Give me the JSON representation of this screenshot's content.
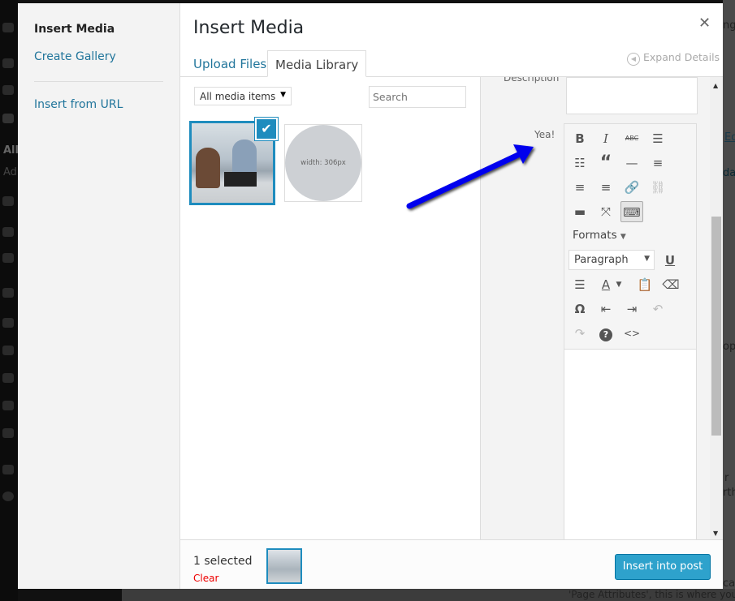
{
  "background": {
    "fragments": [
      "nge",
      "Ed",
      "dat",
      "ope",
      "r",
      "rth",
      "cal",
      "'Page Attributes', this is where you",
      "All",
      "Ad"
    ]
  },
  "left_menu": {
    "items": [
      {
        "label": "Insert Media",
        "active": true
      },
      {
        "label": "Create Gallery",
        "active": false
      },
      {
        "label": "Insert from URL",
        "active": false
      }
    ]
  },
  "header": {
    "title": "Insert Media",
    "close_icon": "close-icon"
  },
  "tabs": [
    {
      "label": "Upload Files"
    },
    {
      "label": "Media Library",
      "active": true
    }
  ],
  "expand_details": "Expand Details",
  "toolbar": {
    "filter_value": "All media items",
    "search_placeholder": "Search"
  },
  "attachments": [
    {
      "type": "photo",
      "selected": true
    },
    {
      "type": "placeholder",
      "text": "width: 306px"
    }
  ],
  "sidebar": {
    "description_label": "Description",
    "yea_label": "Yea!",
    "editor": {
      "buttons": [
        "bold",
        "italic",
        "strikethrough",
        "bullet-list",
        "numbered-list",
        "blockquote",
        "horizontal-rule",
        "align-left",
        "align-center",
        "align-right",
        "link",
        "unlink",
        "read-more",
        "fullscreen",
        "toolbar-toggle",
        "underline",
        "justify",
        "text-color",
        "paste-text",
        "clear-formatting",
        "special-character",
        "outdent",
        "indent",
        "undo",
        "redo",
        "help",
        "code"
      ],
      "formats_label": "Formats",
      "paragraph_value": "Paragraph"
    }
  },
  "footer": {
    "selected_count": "1 selected",
    "clear_label": "Clear",
    "insert_button": "Insert into post"
  },
  "colors": {
    "accent": "#1e8cbe",
    "button": "#2ea2cc",
    "clear": "#e00000",
    "annotation_arrow": "#0000ee"
  }
}
